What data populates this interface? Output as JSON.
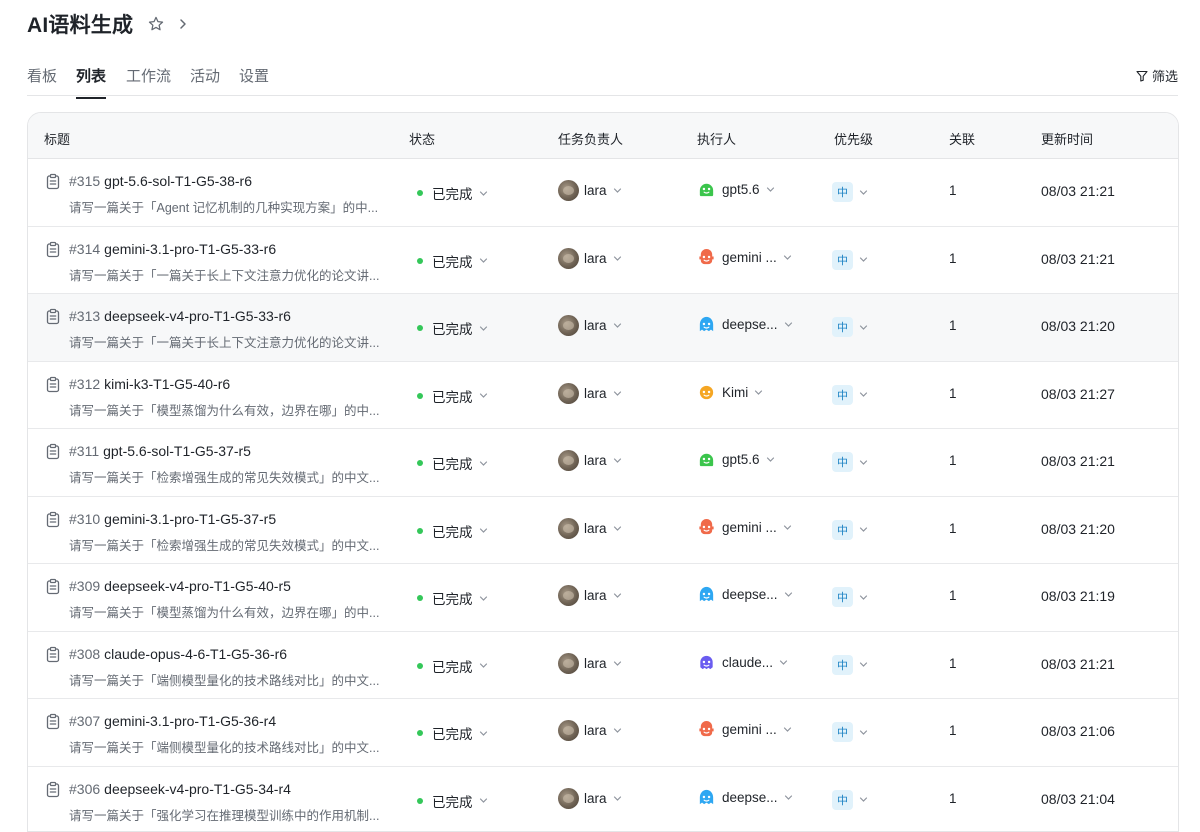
{
  "header": {
    "title": "AI语料生成"
  },
  "tabs": [
    "看板",
    "列表",
    "工作流",
    "活动",
    "设置"
  ],
  "filter_label": "筛选",
  "columns": {
    "title": "标题",
    "status": "状态",
    "owner": "任务负责人",
    "executor": "执行人",
    "priority": "优先级",
    "related": "关联",
    "updated": "更新时间"
  },
  "colors": {
    "gpt": "#3bc54c",
    "gemini": "#f06a4a",
    "deepseek": "#2ea7f2",
    "kimi": "#f5a623",
    "claude": "#6a5cf0",
    "status_done": "#34c759"
  },
  "rows": [
    {
      "num": "#315",
      "name": "gpt-5.6-sol-T1-G5-38-r6",
      "desc": "请写一篇关于「Agent 记忆机制的几种实现方案」的中...",
      "status": "已完成",
      "owner": "lara",
      "executor": "gpt5.6",
      "bot": "gpt",
      "priority": "中",
      "related": "1",
      "time": "08/03 21:21"
    },
    {
      "num": "#314",
      "name": "gemini-3.1-pro-T1-G5-33-r6",
      "desc": "请写一篇关于「一篇关于长上下文注意力优化的论文讲...",
      "status": "已完成",
      "owner": "lara",
      "executor": "gemini ...",
      "bot": "gemini",
      "priority": "中",
      "related": "1",
      "time": "08/03 21:21"
    },
    {
      "num": "#313",
      "name": "deepseek-v4-pro-T1-G5-33-r6",
      "desc": "请写一篇关于「一篇关于长上下文注意力优化的论文讲...",
      "status": "已完成",
      "owner": "lara",
      "executor": "deepse...",
      "bot": "deepseek",
      "priority": "中",
      "related": "1",
      "time": "08/03 21:20"
    },
    {
      "num": "#312",
      "name": "kimi-k3-T1-G5-40-r6",
      "desc": "请写一篇关于「模型蒸馏为什么有效，边界在哪」的中...",
      "status": "已完成",
      "owner": "lara",
      "executor": "Kimi",
      "bot": "kimi",
      "priority": "中",
      "related": "1",
      "time": "08/03 21:27"
    },
    {
      "num": "#311",
      "name": "gpt-5.6-sol-T1-G5-37-r5",
      "desc": "请写一篇关于「检索增强生成的常见失效模式」的中文...",
      "status": "已完成",
      "owner": "lara",
      "executor": "gpt5.6",
      "bot": "gpt",
      "priority": "中",
      "related": "1",
      "time": "08/03 21:21"
    },
    {
      "num": "#310",
      "name": "gemini-3.1-pro-T1-G5-37-r5",
      "desc": "请写一篇关于「检索增强生成的常见失效模式」的中文...",
      "status": "已完成",
      "owner": "lara",
      "executor": "gemini ...",
      "bot": "gemini",
      "priority": "中",
      "related": "1",
      "time": "08/03 21:20"
    },
    {
      "num": "#309",
      "name": "deepseek-v4-pro-T1-G5-40-r5",
      "desc": "请写一篇关于「模型蒸馏为什么有效，边界在哪」的中...",
      "status": "已完成",
      "owner": "lara",
      "executor": "deepse...",
      "bot": "deepseek",
      "priority": "中",
      "related": "1",
      "time": "08/03 21:19"
    },
    {
      "num": "#308",
      "name": "claude-opus-4-6-T1-G5-36-r6",
      "desc": "请写一篇关于「端侧模型量化的技术路线对比」的中文...",
      "status": "已完成",
      "owner": "lara",
      "executor": "claude...",
      "bot": "claude",
      "priority": "中",
      "related": "1",
      "time": "08/03 21:21"
    },
    {
      "num": "#307",
      "name": "gemini-3.1-pro-T1-G5-36-r4",
      "desc": "请写一篇关于「端侧模型量化的技术路线对比」的中文...",
      "status": "已完成",
      "owner": "lara",
      "executor": "gemini ...",
      "bot": "gemini",
      "priority": "中",
      "related": "1",
      "time": "08/03 21:06"
    },
    {
      "num": "#306",
      "name": "deepseek-v4-pro-T1-G5-34-r4",
      "desc": "请写一篇关于「强化学习在推理模型训练中的作用机制...",
      "status": "已完成",
      "owner": "lara",
      "executor": "deepse...",
      "bot": "deepseek",
      "priority": "中",
      "related": "1",
      "time": "08/03 21:04"
    }
  ]
}
